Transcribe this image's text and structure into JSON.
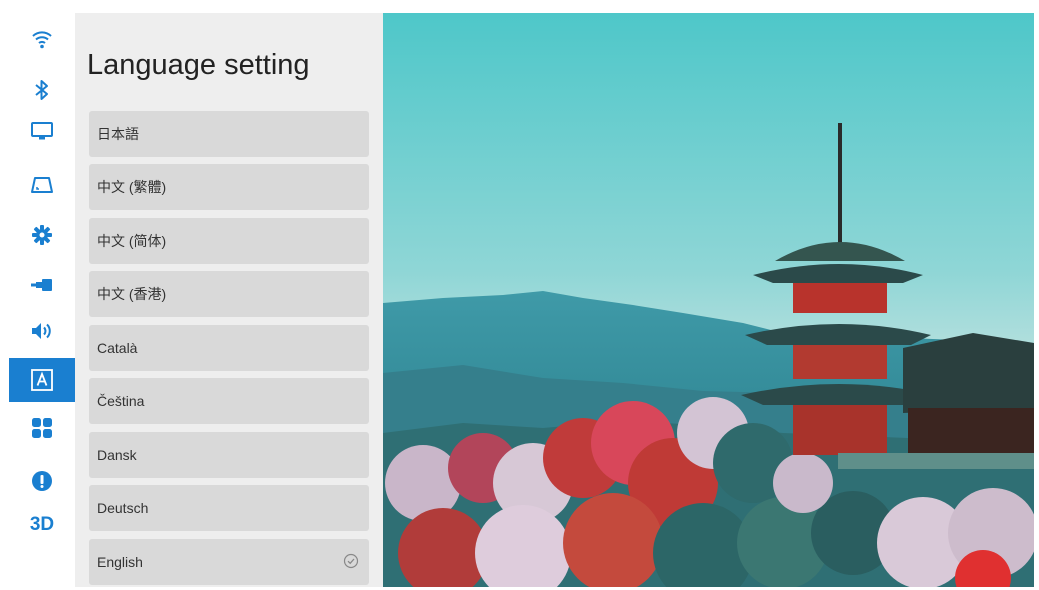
{
  "panel": {
    "title": "Language setting"
  },
  "languages": [
    {
      "label": "日本語",
      "selected": false
    },
    {
      "label": "中文 (繁體)",
      "selected": false
    },
    {
      "label": "中文 (简体)",
      "selected": false
    },
    {
      "label": "中文 (香港)",
      "selected": false
    },
    {
      "label": "Català",
      "selected": false
    },
    {
      "label": "Čeština",
      "selected": false
    },
    {
      "label": "Dansk",
      "selected": false
    },
    {
      "label": "Deutsch",
      "selected": false
    },
    {
      "label": "English",
      "selected": true
    }
  ],
  "sidebar": {
    "items": [
      {
        "icon": "wifi-icon"
      },
      {
        "icon": "bluetooth-icon"
      },
      {
        "icon": "display-icon"
      },
      {
        "icon": "keystone-icon"
      },
      {
        "icon": "gear-icon"
      },
      {
        "icon": "input-source-icon"
      },
      {
        "icon": "volume-icon"
      },
      {
        "icon": "language-icon",
        "active": true
      },
      {
        "icon": "apps-grid-icon"
      },
      {
        "icon": "info-icon"
      },
      {
        "icon": "3d-icon",
        "label": "3D"
      }
    ]
  },
  "colors": {
    "accent": "#1a7fd0",
    "panel_bg": "#eeeeee",
    "item_bg": "#d9d9d9"
  }
}
